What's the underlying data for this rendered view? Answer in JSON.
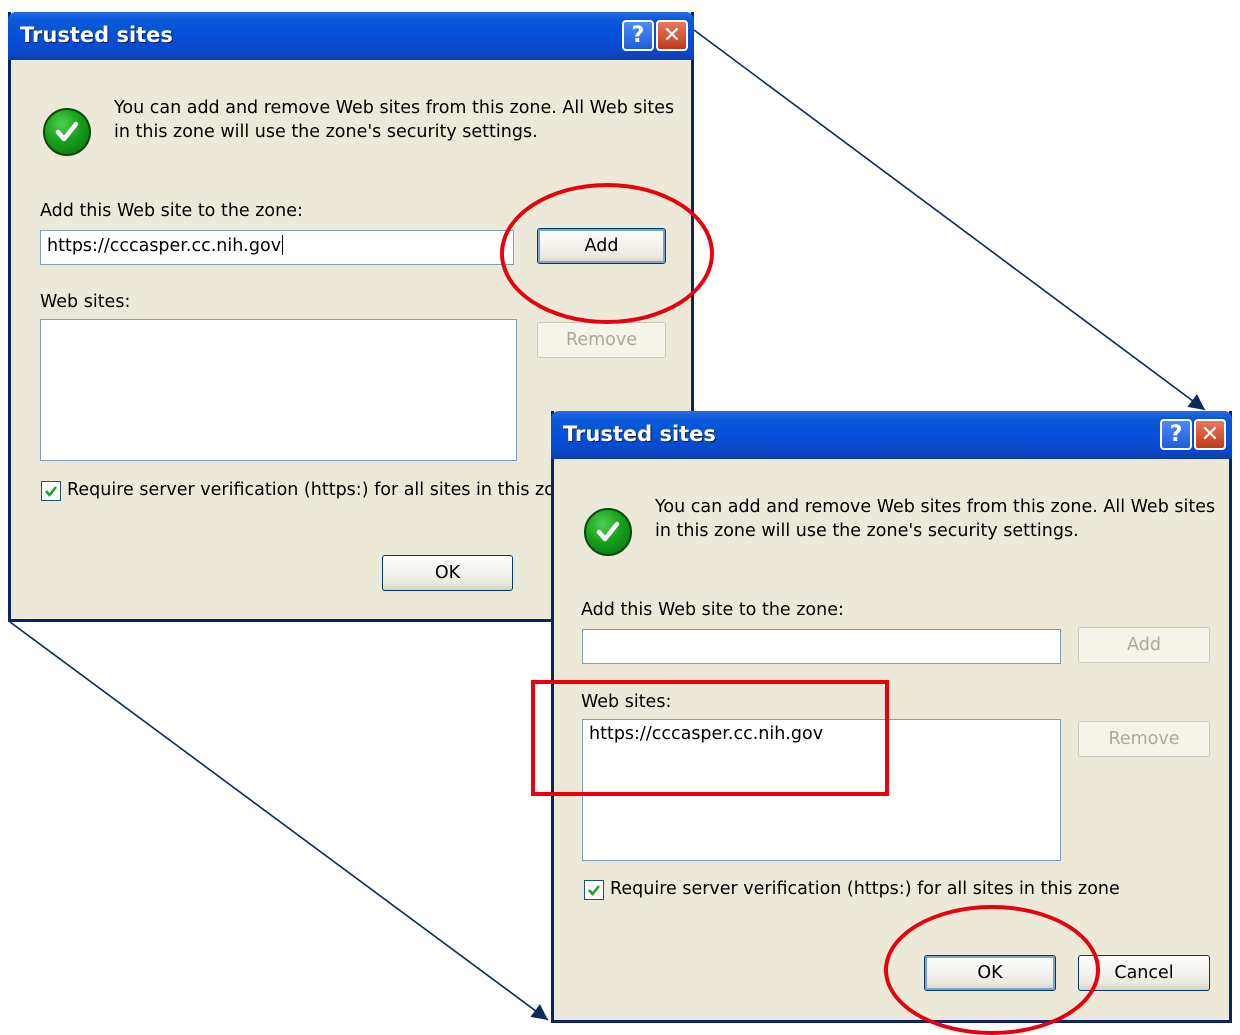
{
  "dialog1": {
    "title": "Trusted sites",
    "help_glyph": "?",
    "close_glyph": "✕",
    "icon": "check-icon",
    "info_line1": "You can add and remove Web sites from this zone. All Web sites",
    "info_line2": "in this zone will use the zone's security settings.",
    "add_label": "Add this Web site to the zone:",
    "add_value": "https://cccasper.cc.nih.gov",
    "add_button": "Add",
    "websites_label": "Web sites:",
    "remove_button": "Remove",
    "require_label": "Require server verification (https:) for all sites in this zo",
    "require_checked": true,
    "ok_button": "OK"
  },
  "dialog2": {
    "title": "Trusted sites",
    "help_glyph": "?",
    "close_glyph": "✕",
    "icon": "check-icon",
    "info_line1": "You can add and remove Web sites from this zone. All Web sites",
    "info_line2": "in this zone will use the zone's security settings.",
    "add_label": "Add this Web site to the zone:",
    "add_value": "",
    "add_button": "Add",
    "websites_label": "Web sites:",
    "website_entries": [
      "https://cccasper.cc.nih.gov"
    ],
    "remove_button": "Remove",
    "require_label": "Require server verification (https:) for all sites in this zone",
    "require_checked": true,
    "ok_button": "OK",
    "cancel_button": "Cancel"
  },
  "colors": {
    "titlebar": "#0550d8",
    "dialog_bg": "#ece9d8",
    "callout": "#e8000c",
    "arrow": "#0a2a5a"
  }
}
